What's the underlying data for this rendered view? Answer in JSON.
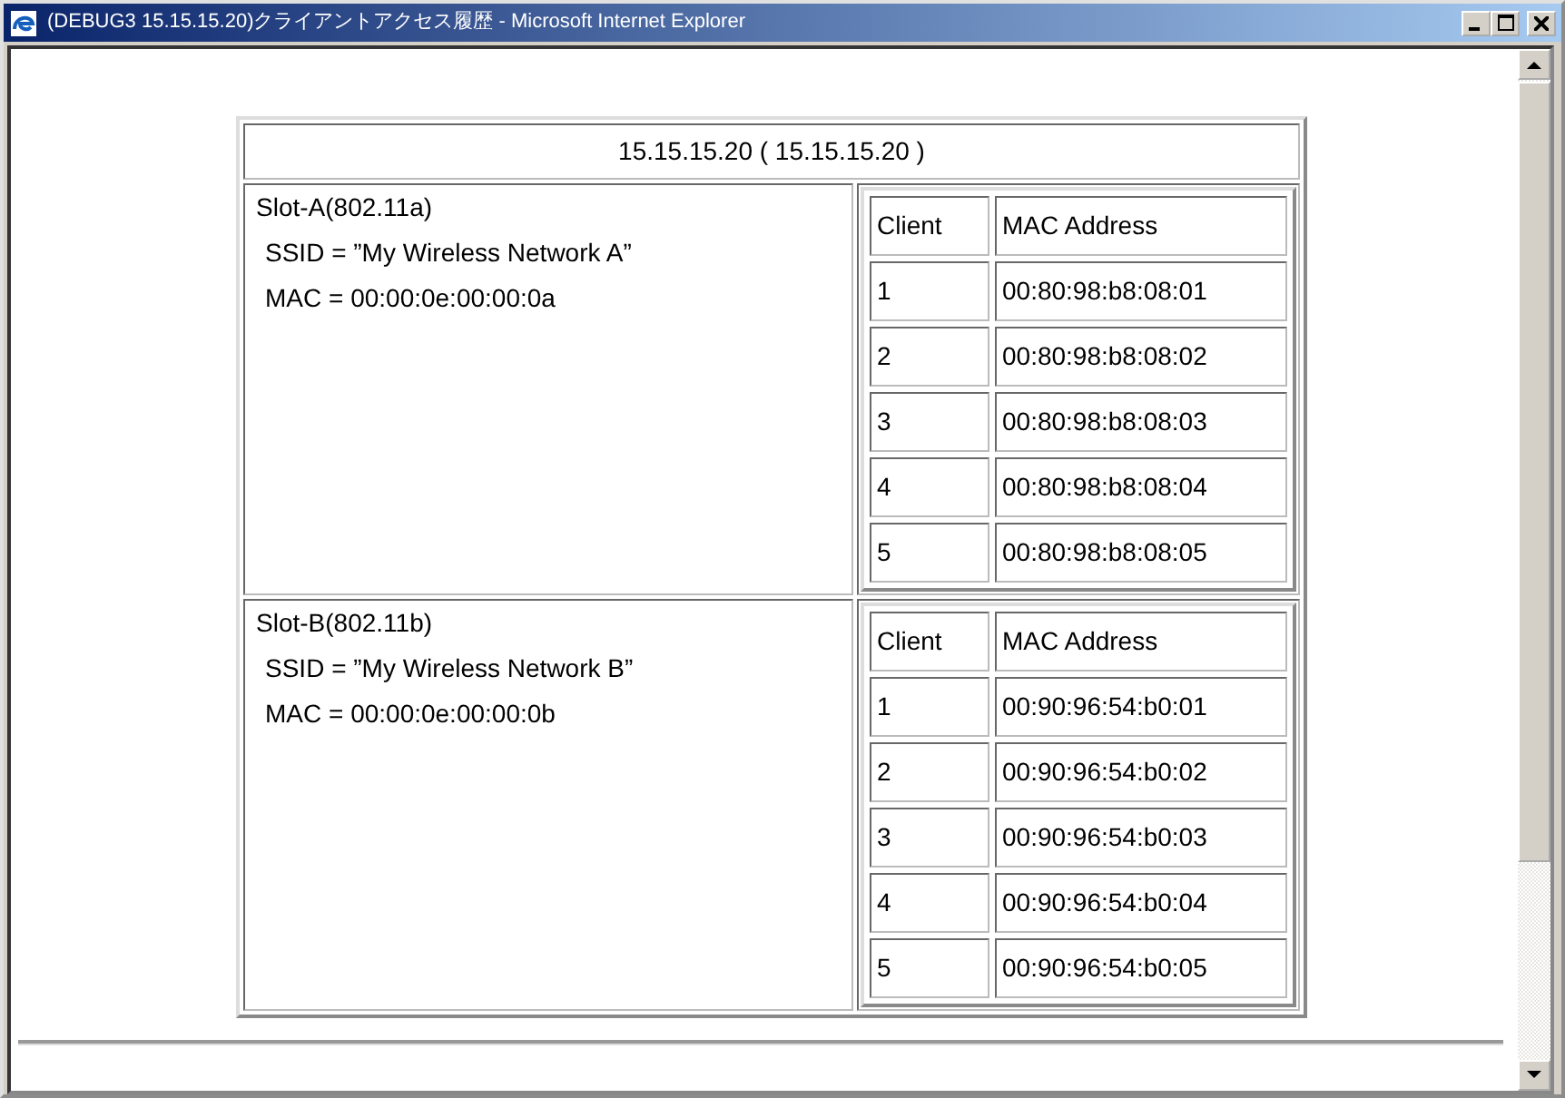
{
  "window": {
    "title": "(DEBUG3 15.15.15.20)クライアントアクセス履歴 - Microsoft Internet Explorer"
  },
  "host": "15.15.15.20 ( 15.15.15.20 )",
  "slots": [
    {
      "name": "Slot-A(802.11a)",
      "ssid": "SSID = ”My Wireless Network A”",
      "mac": "MAC = 00:00:0e:00:00:0a",
      "columns": [
        "Client",
        "MAC Address"
      ],
      "rows": [
        [
          "1",
          "00:80:98:b8:08:01"
        ],
        [
          "2",
          "00:80:98:b8:08:02"
        ],
        [
          "3",
          "00:80:98:b8:08:03"
        ],
        [
          "4",
          "00:80:98:b8:08:04"
        ],
        [
          "5",
          "00:80:98:b8:08:05"
        ]
      ]
    },
    {
      "name": "Slot-B(802.11b)",
      "ssid": "SSID = ”My Wireless Network B”",
      "mac": "MAC = 00:00:0e:00:00:0b",
      "columns": [
        "Client",
        "MAC Address"
      ],
      "rows": [
        [
          "1",
          "00:90:96:54:b0:01"
        ],
        [
          "2",
          "00:90:96:54:b0:02"
        ],
        [
          "3",
          "00:90:96:54:b0:03"
        ],
        [
          "4",
          "00:90:96:54:b0:04"
        ],
        [
          "5",
          "00:90:96:54:b0:05"
        ]
      ]
    }
  ]
}
